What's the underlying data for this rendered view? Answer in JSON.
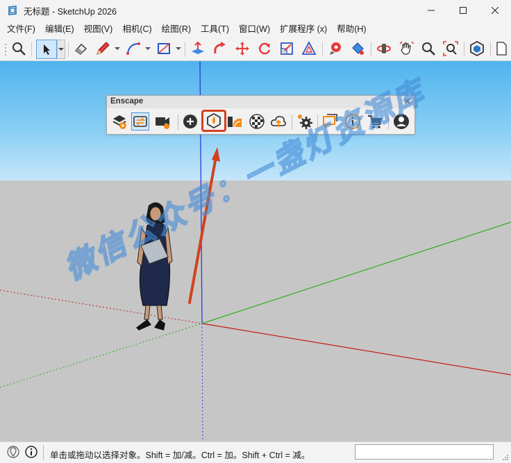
{
  "window": {
    "title": "无标题 - SketchUp 2026"
  },
  "menu": [
    {
      "label": "文件(F)"
    },
    {
      "label": "编辑(E)"
    },
    {
      "label": "视图(V)"
    },
    {
      "label": "相机(C)"
    },
    {
      "label": "绘图(R)"
    },
    {
      "label": "工具(T)"
    },
    {
      "label": "窗口(W)"
    },
    {
      "label": "扩展程序 (x)"
    },
    {
      "label": "帮助(H)"
    }
  ],
  "toolbar": {
    "tools": [
      "zoom-extents",
      "select",
      "eraser",
      "pencil",
      "arc",
      "rectangle",
      "push-pull",
      "follow-me",
      "move",
      "rotate",
      "scale",
      "offset",
      "tape-measure",
      "paint-bucket",
      "orbit",
      "pan",
      "zoom",
      "zoom-window",
      "extension-warehouse",
      "new-document"
    ]
  },
  "enscape": {
    "title": "Enscape",
    "close": "✕",
    "highlighted_tool": "enscape-render-icon"
  },
  "colors": {
    "sky_top": "#4fb4ed",
    "ground": "#c6c6c6",
    "blue_axis": "#2a3bd8",
    "red_axis": "#c81c1c",
    "green_axis": "#2fae1e",
    "annotation_red": "#d2411f"
  },
  "watermark": {
    "text": "微信公众号：一盏灯资源库"
  },
  "status": {
    "hint": "单击或拖动以选择对象。Shift = 加/减。Ctrl = 加。Shift + Ctrl = 减。",
    "measurements": ""
  }
}
